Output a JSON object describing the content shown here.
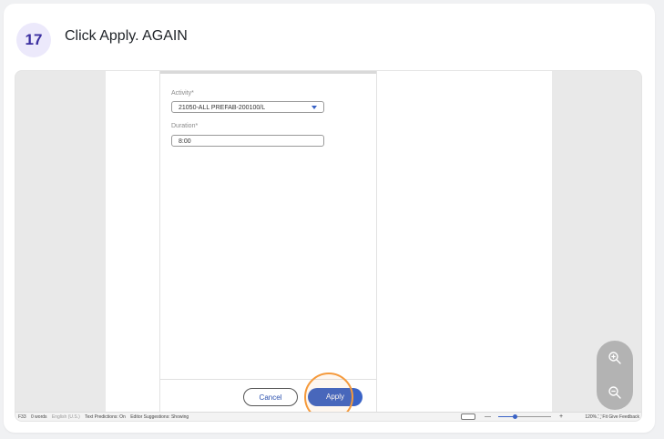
{
  "step": {
    "number": "17",
    "instruction": "Click Apply. AGAIN"
  },
  "form": {
    "activity_label": "Activity*",
    "activity_value": "21050-ALL PREFAB-200100/L",
    "duration_label": "Duration*",
    "duration_value": "8:00",
    "cancel_label": "Cancel",
    "apply_label": "Apply"
  },
  "statusbar": {
    "page": "F33",
    "words": "0 words",
    "language": "English (U.S.)",
    "text_predictions": "Text Predictions: On",
    "editor_suggestions": "Editor Suggestions: Showing",
    "zoom_minus": "—",
    "zoom_plus": "+",
    "zoom_level": "120%",
    "fit": "Fit",
    "feedback": "Give Feedback",
    "zoom_fraction": 0.3
  },
  "icons": {
    "zoom_in": "zoom-in-icon",
    "zoom_out": "zoom-out-icon",
    "dropdown": "chevron-down-icon"
  },
  "colors": {
    "accent": "#3a63c6",
    "highlight": "#f59a3c",
    "badge_bg": "#ece9fb",
    "badge_text": "#3b2fa0"
  }
}
